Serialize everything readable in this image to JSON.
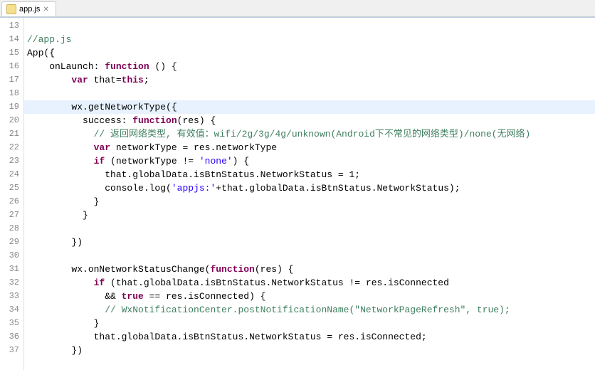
{
  "tab": {
    "filename": "app.js"
  },
  "lines": [
    {
      "num": 13,
      "segs": []
    },
    {
      "num": 14,
      "segs": [
        {
          "cls": "c-comment",
          "text": "//app.js"
        }
      ]
    },
    {
      "num": 15,
      "segs": [
        {
          "cls": "c-default",
          "text": "App({"
        }
      ]
    },
    {
      "num": 16,
      "segs": [
        {
          "cls": "c-default",
          "text": "    onLaunch: "
        },
        {
          "cls": "c-keyword",
          "text": "function"
        },
        {
          "cls": "c-default",
          "text": " () {"
        }
      ]
    },
    {
      "num": 17,
      "segs": [
        {
          "cls": "c-default",
          "text": "        "
        },
        {
          "cls": "c-keyword",
          "text": "var"
        },
        {
          "cls": "c-default",
          "text": " that="
        },
        {
          "cls": "c-keyword",
          "text": "this"
        },
        {
          "cls": "c-default",
          "text": ";"
        }
      ]
    },
    {
      "num": 18,
      "segs": []
    },
    {
      "num": 19,
      "highlighted": true,
      "segs": [
        {
          "cls": "c-default",
          "text": "        wx.getNetworkType({"
        }
      ]
    },
    {
      "num": 20,
      "segs": [
        {
          "cls": "c-default",
          "text": "          success: "
        },
        {
          "cls": "c-keyword",
          "text": "function"
        },
        {
          "cls": "c-default",
          "text": "(res) {"
        }
      ]
    },
    {
      "num": 21,
      "segs": [
        {
          "cls": "c-default",
          "text": "            "
        },
        {
          "cls": "c-comment",
          "text": "// 返回网络类型, 有效值：wifi/2g/3g/4g/unknown(Android下不常见的网络类型)/none(无网络)"
        }
      ]
    },
    {
      "num": 22,
      "segs": [
        {
          "cls": "c-default",
          "text": "            "
        },
        {
          "cls": "c-keyword",
          "text": "var"
        },
        {
          "cls": "c-default",
          "text": " networkType = res.networkType"
        }
      ]
    },
    {
      "num": 23,
      "segs": [
        {
          "cls": "c-default",
          "text": "            "
        },
        {
          "cls": "c-keyword",
          "text": "if"
        },
        {
          "cls": "c-default",
          "text": " (networkType != "
        },
        {
          "cls": "c-string",
          "text": "'none'"
        },
        {
          "cls": "c-default",
          "text": ") {"
        }
      ]
    },
    {
      "num": 24,
      "segs": [
        {
          "cls": "c-default",
          "text": "              that.globalData.isBtnStatus.NetworkStatus = 1;"
        }
      ]
    },
    {
      "num": 25,
      "segs": [
        {
          "cls": "c-default",
          "text": "              console.log("
        },
        {
          "cls": "c-string",
          "text": "'appjs:'"
        },
        {
          "cls": "c-default",
          "text": "+that.globalData.isBtnStatus.NetworkStatus);"
        }
      ]
    },
    {
      "num": 26,
      "segs": [
        {
          "cls": "c-default",
          "text": "            }"
        }
      ]
    },
    {
      "num": 27,
      "segs": [
        {
          "cls": "c-default",
          "text": "          }"
        }
      ]
    },
    {
      "num": 28,
      "segs": []
    },
    {
      "num": 29,
      "segs": [
        {
          "cls": "c-default",
          "text": "        })"
        }
      ]
    },
    {
      "num": 30,
      "segs": []
    },
    {
      "num": 31,
      "segs": [
        {
          "cls": "c-default",
          "text": "        wx.onNetworkStatusChange("
        },
        {
          "cls": "c-keyword",
          "text": "function"
        },
        {
          "cls": "c-default",
          "text": "(res) {"
        }
      ]
    },
    {
      "num": 32,
      "segs": [
        {
          "cls": "c-default",
          "text": "            "
        },
        {
          "cls": "c-keyword",
          "text": "if"
        },
        {
          "cls": "c-default",
          "text": " (that.globalData.isBtnStatus.NetworkStatus != res.isConnected"
        }
      ]
    },
    {
      "num": 33,
      "segs": [
        {
          "cls": "c-default",
          "text": "              && "
        },
        {
          "cls": "c-keyword",
          "text": "true"
        },
        {
          "cls": "c-default",
          "text": " == res.isConnected) {"
        }
      ]
    },
    {
      "num": 34,
      "segs": [
        {
          "cls": "c-default",
          "text": "              "
        },
        {
          "cls": "c-comment",
          "text": "// WxNotificationCenter.postNotificationName(\"NetworkPageRefresh\", true);"
        }
      ]
    },
    {
      "num": 35,
      "segs": [
        {
          "cls": "c-default",
          "text": "            }"
        }
      ]
    },
    {
      "num": 36,
      "segs": [
        {
          "cls": "c-default",
          "text": "            that.globalData.isBtnStatus.NetworkStatus = res.isConnected;"
        }
      ]
    },
    {
      "num": 37,
      "segs": [
        {
          "cls": "c-default",
          "text": "        })"
        }
      ]
    }
  ]
}
